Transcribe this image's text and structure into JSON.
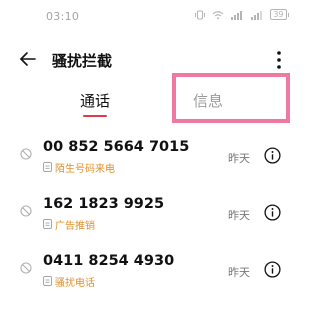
{
  "status_bar": {
    "time": "03:10",
    "battery_level": "39"
  },
  "app_bar": {
    "title": "骚扰拦截"
  },
  "tabs": [
    {
      "label": "通话",
      "active": true
    },
    {
      "label": "信息",
      "active": false
    }
  ],
  "records": [
    {
      "number": "00 852 5664 7015",
      "tag": "陌生号码来电",
      "date": "昨天"
    },
    {
      "number": "162 1823 9925",
      "tag": "广告推销",
      "date": "昨天"
    },
    {
      "number": "0411 8254 4930",
      "tag": "骚扰电话",
      "date": "昨天"
    }
  ],
  "colors": {
    "accent": "#e03a4a",
    "tag": "#e0902a",
    "highlight": "#ee7aa3"
  },
  "icons": [
    "back-arrow-icon",
    "more-vertical-icon",
    "block-icon",
    "tag-icon",
    "info-icon",
    "vibrate-icon",
    "wifi-icon",
    "signal-icon",
    "battery-icon"
  ]
}
